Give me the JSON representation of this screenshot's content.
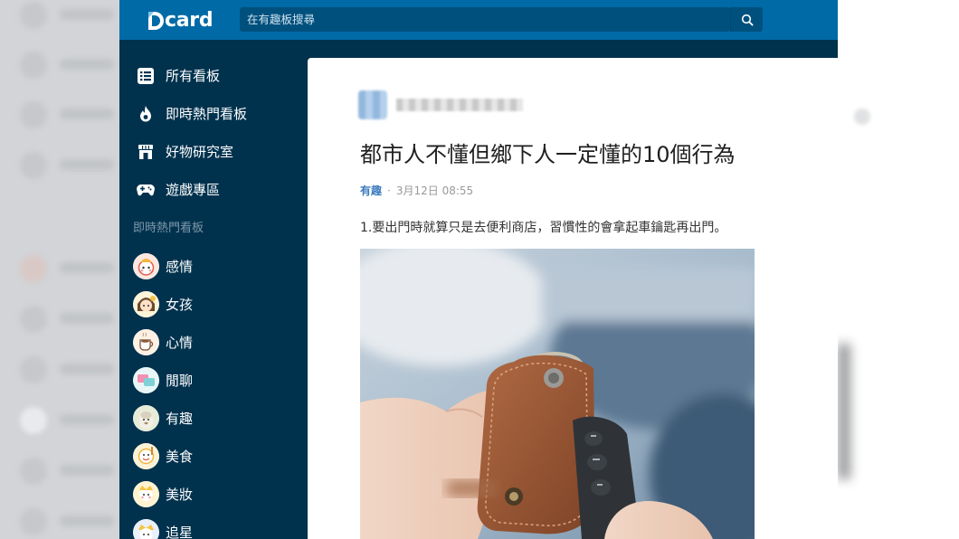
{
  "header": {
    "logo_text": "card",
    "search_placeholder": "在有趣板搜尋"
  },
  "sidebar": {
    "nav": [
      {
        "label": "所有看板",
        "icon": "list-icon"
      },
      {
        "label": "即時熱門看板",
        "icon": "flame-icon"
      },
      {
        "label": "好物研究室",
        "icon": "store-icon"
      },
      {
        "label": "遊戲專區",
        "icon": "gamepad-icon"
      }
    ],
    "section_title": "即時熱門看板",
    "boards": [
      {
        "label": "感情"
      },
      {
        "label": "女孩"
      },
      {
        "label": "心情"
      },
      {
        "label": "閒聊"
      },
      {
        "label": "有趣"
      },
      {
        "label": "美食"
      },
      {
        "label": "美妝"
      },
      {
        "label": "追星"
      }
    ]
  },
  "post": {
    "title": "都市人不懂但鄉下人一定懂的10個行為",
    "board": "有趣",
    "date": "3月12日 08:55",
    "body": "1.要出門時就算只是去便利商店，習慣性的會拿起車鑰匙再出門。"
  },
  "colors": {
    "header": "#006aa6",
    "sidebar": "#00324e",
    "search": "#00507e",
    "board_link": "#3b7bbf"
  }
}
